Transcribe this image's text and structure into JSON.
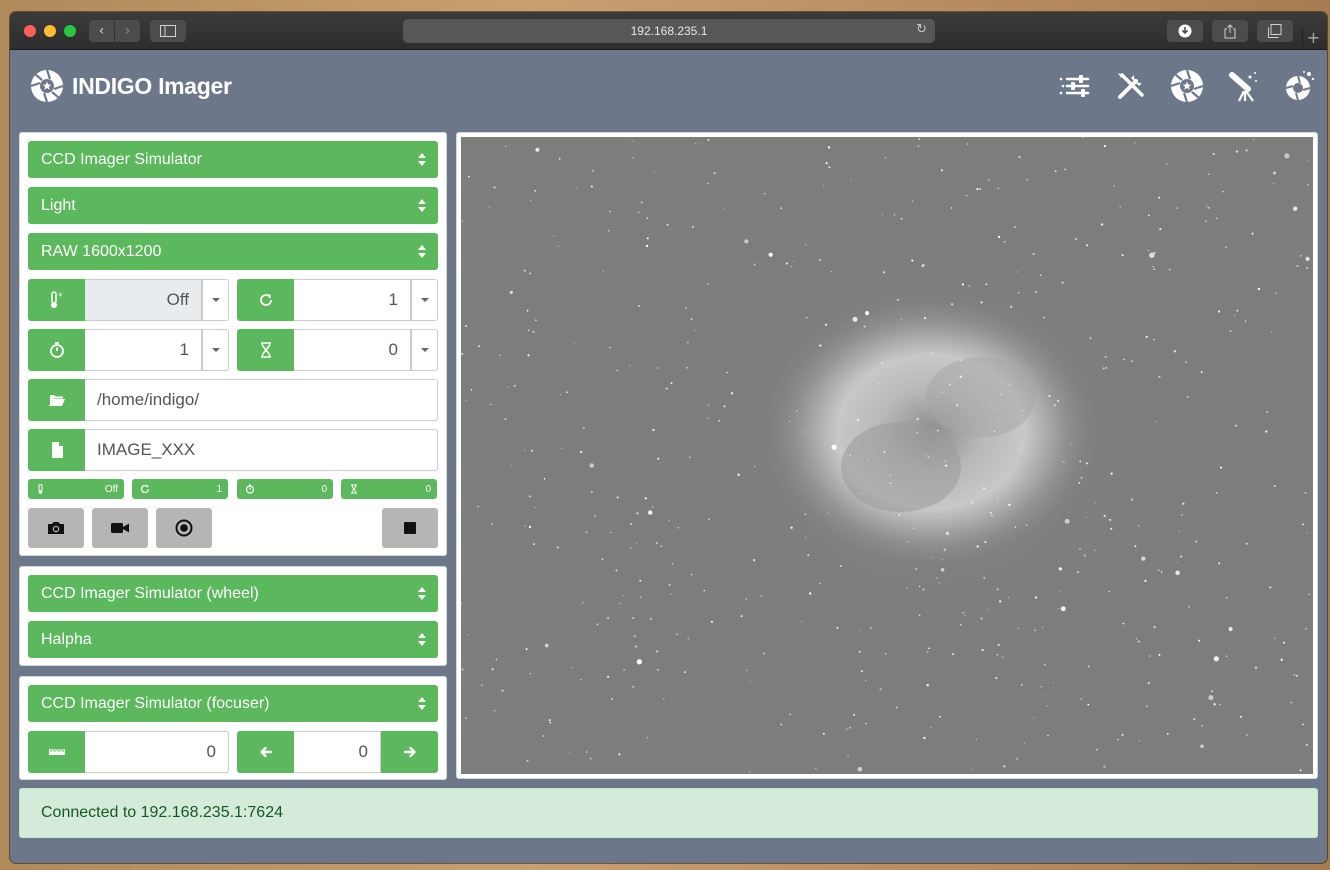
{
  "browser": {
    "url": "192.168.235.1"
  },
  "app": {
    "title": "INDIGO Imager",
    "header_icons": [
      "sliders-icon",
      "tools-icon",
      "imager-icon",
      "telescope-icon",
      "guider-icon"
    ]
  },
  "imager": {
    "device": "CCD Imager Simulator",
    "frame_type": "Light",
    "mode": "RAW 1600x1200",
    "cooler": "Off",
    "count": "1",
    "exposure": "1",
    "delay": "0",
    "directory": "/home/indigo/",
    "filename": "IMAGE_XXX",
    "status": {
      "cooler": "Off",
      "count": "1",
      "exposure": "0",
      "delay": "0"
    }
  },
  "wheel": {
    "device": "CCD Imager Simulator (wheel)",
    "filter": "Halpha"
  },
  "focuser": {
    "device": "CCD Imager Simulator (focuser)",
    "position": "0",
    "steps": "0"
  },
  "status_message": "Connected to 192.168.235.1:7624",
  "colors": {
    "accent": "#5cb85c",
    "background": "#6c7889",
    "alert_bg": "#d5ebd9",
    "alert_text": "#155724"
  }
}
